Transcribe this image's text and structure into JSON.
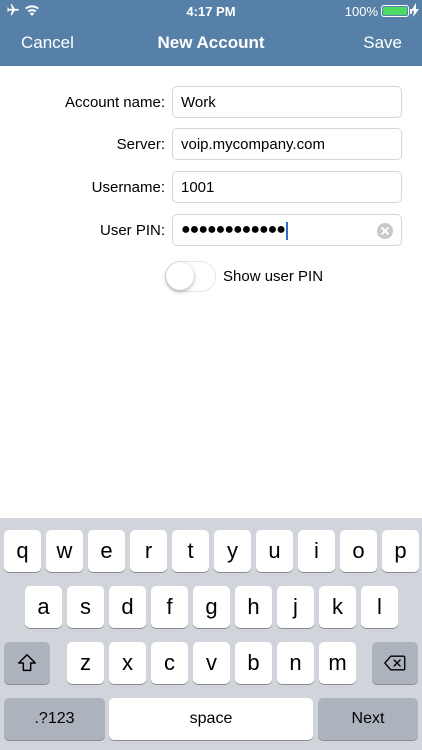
{
  "status_bar": {
    "time": "4:17 PM",
    "battery_percent": "100%",
    "battery_color": "#4cd964",
    "icons": [
      "airplane-icon",
      "wifi-icon",
      "battery-icon",
      "charging-bolt-icon"
    ]
  },
  "nav": {
    "background": "#5680a8",
    "cancel_label": "Cancel",
    "title": "New Account",
    "save_label": "Save"
  },
  "form": {
    "account_name": {
      "label": "Account name:",
      "value": "Work"
    },
    "server": {
      "label": "Server:",
      "value": "voip.mycompany.com"
    },
    "username": {
      "label": "Username:",
      "value": "1001"
    },
    "user_pin": {
      "label": "User PIN:",
      "masked_value": "●●●●●●●●●●●●"
    },
    "show_pin": {
      "label": "Show user PIN",
      "on": false
    }
  },
  "keyboard": {
    "row1": [
      "q",
      "w",
      "e",
      "r",
      "t",
      "y",
      "u",
      "i",
      "o",
      "p"
    ],
    "row2": [
      "a",
      "s",
      "d",
      "f",
      "g",
      "h",
      "j",
      "k",
      "l"
    ],
    "row3": [
      "z",
      "x",
      "c",
      "v",
      "b",
      "n",
      "m"
    ],
    "numbers_label": ".?123",
    "space_label": "space",
    "next_label": "Next",
    "icons": [
      "shift-icon",
      "backspace-icon"
    ]
  }
}
